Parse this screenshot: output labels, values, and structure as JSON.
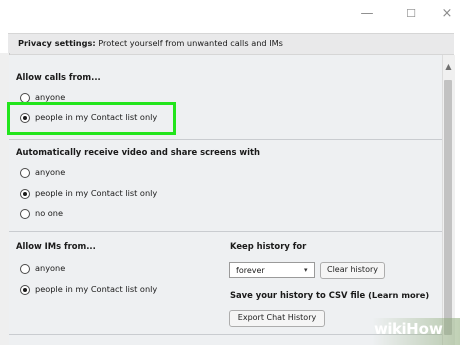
{
  "window": {
    "minimize_glyph": "—",
    "maximize_glyph": "☐",
    "close_glyph": "×"
  },
  "header": {
    "bold": "Privacy settings:",
    "text": " Protect yourself from unwanted calls and IMs"
  },
  "calls": {
    "title": "Allow calls from...",
    "options": [
      {
        "label": "anyone",
        "selected": false
      },
      {
        "label": "people in my Contact list only",
        "selected": true
      }
    ]
  },
  "video": {
    "title": "Automatically receive video and share screens with",
    "options": [
      {
        "label": "anyone",
        "selected": false
      },
      {
        "label": "people in my Contact list only",
        "selected": true
      },
      {
        "label": "no one",
        "selected": false
      }
    ]
  },
  "ims": {
    "title": "Allow IMs from...",
    "options": [
      {
        "label": "anyone",
        "selected": false
      },
      {
        "label": "people in my Contact list only",
        "selected": true
      }
    ]
  },
  "history": {
    "title": "Keep history for",
    "selected": "forever",
    "clear_label": "Clear history",
    "csv_title": "Save your history to CSV file",
    "learn_more": "(Learn more)",
    "export_label": "Export Chat History"
  },
  "highlight_color": "#22e51c",
  "watermark": {
    "wiki": "wiki",
    "how": "How"
  }
}
